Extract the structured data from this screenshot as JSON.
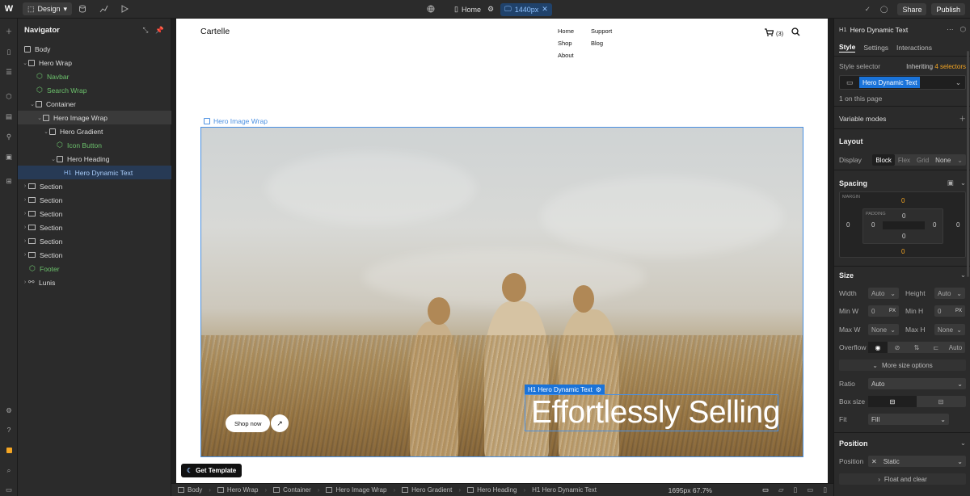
{
  "topbar": {
    "mode_label": "Design",
    "page_label": "Home",
    "breakpoint_label": "1440px",
    "share_label": "Share",
    "publish_label": "Publish"
  },
  "navigator": {
    "title": "Navigator",
    "items": [
      {
        "label": "Body",
        "type": "box"
      },
      {
        "label": "Hero Wrap",
        "type": "box"
      },
      {
        "label": "Navbar",
        "type": "component"
      },
      {
        "label": "Search Wrap",
        "type": "component"
      },
      {
        "label": "Container",
        "type": "box"
      },
      {
        "label": "Hero Image Wrap",
        "type": "box"
      },
      {
        "label": "Hero Gradient",
        "type": "box"
      },
      {
        "label": "Icon Button",
        "type": "component"
      },
      {
        "label": "Hero Heading",
        "type": "box"
      },
      {
        "label": "Hero Dynamic Text",
        "type": "h1",
        "tag": "H1"
      },
      {
        "label": "Section",
        "type": "section"
      },
      {
        "label": "Section",
        "type": "section"
      },
      {
        "label": "Section",
        "type": "section"
      },
      {
        "label": "Section",
        "type": "section"
      },
      {
        "label": "Section",
        "type": "section"
      },
      {
        "label": "Section",
        "type": "section"
      },
      {
        "label": "Footer",
        "type": "component"
      },
      {
        "label": "Lunis",
        "type": "link"
      }
    ]
  },
  "site": {
    "logo": "Cartelle",
    "nav": [
      "Home",
      "Support",
      "Shop",
      "Blog",
      "About"
    ],
    "cart_count": "(3)",
    "hero_label": "Hero Image Wrap",
    "shop_button": "Shop now",
    "selection_tag": "H1  Hero Dynamic Text",
    "hero_heading": "Effortlessly Selling"
  },
  "get_template_label": "Get Template",
  "breadcrumbs": [
    "Body",
    "Hero Wrap",
    "Container",
    "Hero Image Wrap",
    "Hero Gradient",
    "Hero Heading",
    "H1  Hero Dynamic Text"
  ],
  "zoom_readout": "1695px 67.7%",
  "panel": {
    "element_title": "Hero Dynamic Text",
    "element_tag": "H1",
    "tabs": [
      "Style",
      "Settings",
      "Interactions"
    ],
    "style_selector_label": "Style selector",
    "inheriting_prefix": "Inheriting ",
    "inheriting_count": "4 selectors",
    "selector_chip": "Hero Dynamic Text",
    "on_page": "1 on this page",
    "variable_modes": "Variable modes",
    "layout_head": "Layout",
    "display_label": "Display",
    "display_options": [
      "Block",
      "Flex",
      "Grid",
      "None"
    ],
    "spacing_head": "Spacing",
    "margin_label": "MARGIN",
    "padding_label": "PADDING",
    "margin": {
      "top": "0",
      "right": "0",
      "bottom": "0",
      "left": "0"
    },
    "padding": {
      "top": "0",
      "right": "0",
      "bottom": "0",
      "left": "0"
    },
    "size_head": "Size",
    "width_label": "Width",
    "width_value": "Auto",
    "height_label": "Height",
    "height_value": "Auto",
    "minw_label": "Min W",
    "minw_value": "0",
    "minw_unit": "PX",
    "minh_label": "Min H",
    "minh_value": "0",
    "minh_unit": "PX",
    "maxw_label": "Max W",
    "maxw_value": "None",
    "maxh_label": "Max H",
    "maxh_value": "None",
    "overflow_label": "Overflow",
    "overflow_auto": "Auto",
    "more_size": "More size options",
    "ratio_label": "Ratio",
    "ratio_value": "Auto",
    "boxsize_label": "Box size",
    "fit_label": "Fit",
    "fit_value": "Fill",
    "position_head": "Position",
    "position_label": "Position",
    "position_value": "Static",
    "float_label": "Float and clear"
  },
  "colors": {
    "accent": "#1a73d9",
    "component_green": "#6cc26c",
    "margin_orange": "#f5a623",
    "canvas_bg": "#1e1e1e",
    "panel_bg": "#2b2b2b"
  }
}
